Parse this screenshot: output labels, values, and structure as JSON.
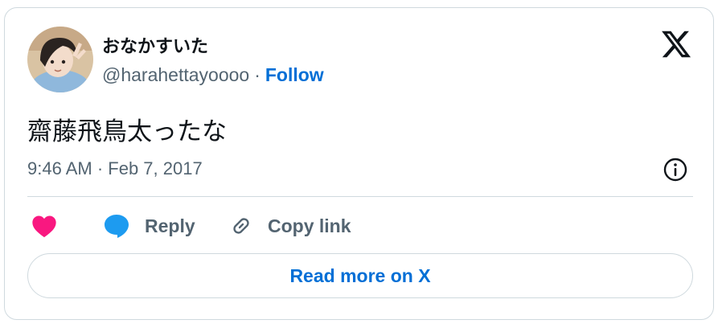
{
  "author": {
    "display_name": "おなかすいた",
    "handle": "@harahettayoooo",
    "separator": "·",
    "follow_label": "Follow"
  },
  "tweet": {
    "text": "齋藤飛鳥太ったな",
    "timestamp": "9:46 AM · Feb 7, 2017"
  },
  "actions": {
    "reply_label": "Reply",
    "copy_link_label": "Copy link"
  },
  "read_more_label": "Read more on X",
  "colors": {
    "accent": "#006fd6",
    "like": "#f91880",
    "reply": "#1d9bf0",
    "text_primary": "#0f1419",
    "text_secondary": "#536471",
    "border": "#cfd9de"
  },
  "icons": {
    "logo": "x-logo-icon",
    "info": "info-icon",
    "like": "heart-icon",
    "reply": "speech-bubble-icon",
    "copy": "link-icon"
  }
}
